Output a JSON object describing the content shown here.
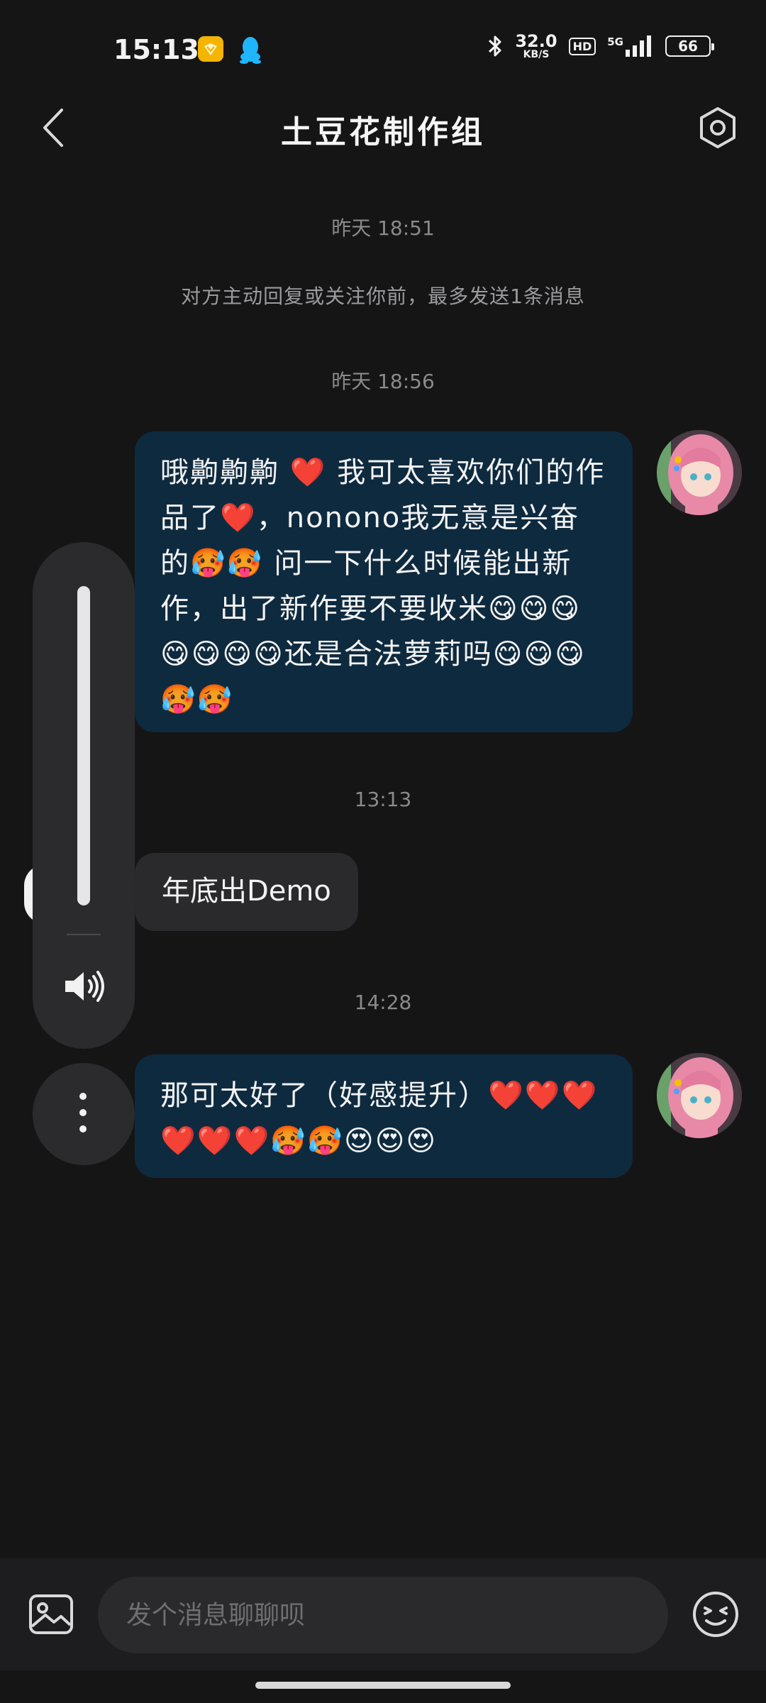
{
  "status_bar": {
    "time": "15:13",
    "speed_value": "32.0",
    "speed_unit": "KB/S",
    "hd": "HD",
    "network": "5G",
    "battery": "66"
  },
  "header": {
    "title": "土豆花制作组"
  },
  "messages": [
    {
      "type": "timestamp",
      "text": "昨天 18:51"
    },
    {
      "type": "system",
      "text": "对方主动回复或关注你前，最多发送1条消息"
    },
    {
      "type": "timestamp",
      "text": "昨天 18:56"
    },
    {
      "type": "outgoing",
      "text": "哦齁齁齁 ❤️  我可太喜欢你们的作品了❤️，nonono我无意是兴奋的🥵🥵        问一下什么时候能出新作，出了新作要不要收米😋😋😋😋😋😋😋还是合法萝莉吗😋😋😋🥵🥵"
    },
    {
      "type": "timestamp",
      "text": "13:13"
    },
    {
      "type": "incoming",
      "text": "年底出Demo"
    },
    {
      "type": "timestamp",
      "text": "14:28"
    },
    {
      "type": "outgoing",
      "text": "那可太好了（好感提升）❤️❤️❤️❤️❤️❤️🥵🥵😍😍😍"
    }
  ],
  "input": {
    "placeholder": "发个消息聊聊呗"
  },
  "icons": {
    "back": "chevron-left-icon",
    "settings": "hexagon-gear-icon",
    "image": "image-icon",
    "emoji": "emoji-face-icon",
    "volume": "speaker-icon",
    "more": "more-vertical-icon"
  },
  "colors": {
    "background": "#151516",
    "outgoing_bubble": "#0e2a3f",
    "incoming_bubble": "#2a2a2c",
    "vip_badge": "#f4b400",
    "qq_icon": "#1fb6ff"
  }
}
